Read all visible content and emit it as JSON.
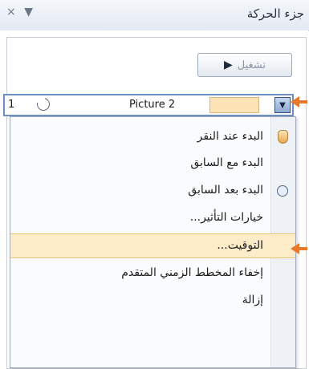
{
  "pane": {
    "title": "جزء الحركة",
    "close_glyph": "×",
    "menu_glyph": "▼"
  },
  "play_button": {
    "label": "تشغيل",
    "icon": "play-icon"
  },
  "animation_row": {
    "index": "1",
    "effect_icon": "circle-arrow-icon",
    "name": "Picture 2",
    "dropdown_glyph": "▼"
  },
  "menu": {
    "items": [
      {
        "label": "البدء عند النقر",
        "icon": "mouse-icon",
        "highlight": false
      },
      {
        "label": "البدء مع السابق",
        "icon": "",
        "highlight": false
      },
      {
        "label": "البدء بعد السابق",
        "icon": "clock-icon",
        "highlight": false
      },
      {
        "label": "خيارات التأثير...",
        "icon": "",
        "highlight": false
      },
      {
        "label": "التوقيت...",
        "icon": "",
        "highlight": true
      },
      {
        "label": "إخفاء المخطط الزمني المتقدم",
        "icon": "",
        "highlight": false
      },
      {
        "label": "إزالة",
        "icon": "",
        "highlight": false
      }
    ]
  },
  "colors": {
    "accent_arrow": "#e8792c",
    "highlight_bg": "#fcecc8",
    "timing_bar": "#fbe3b6"
  }
}
